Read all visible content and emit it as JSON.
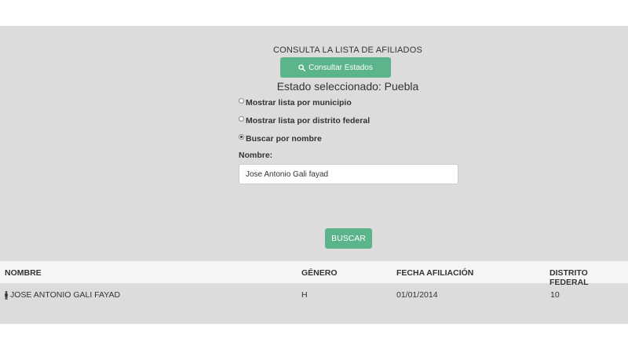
{
  "header": {
    "title": "CONSULTA LA LISTA DE AFILIADOS",
    "consultar_button": "Consultar Estados",
    "estado_label": "Estado seleccionado: Puebla"
  },
  "options": [
    {
      "label": "Mostrar lista por municipio",
      "checked": false
    },
    {
      "label": "Mostrar lista por distrito federal",
      "checked": false
    },
    {
      "label": "Buscar por nombre",
      "checked": true
    }
  ],
  "form": {
    "nombre_label": "Nombre:",
    "nombre_value": "Jose Antonio Gali fayad",
    "buscar_button": "BUSCAR"
  },
  "table": {
    "columns": [
      "NOMBRE",
      "GÉNERO",
      "FECHA AFILIACIÓN",
      "DISTRITO FEDERAL"
    ],
    "rows": [
      {
        "nombre": "JOSE ANTONIO GALI FAYAD",
        "genero": "H",
        "fecha": "01/01/2014",
        "distrito": "10",
        "icon": "male-user-icon"
      }
    ]
  },
  "colors": {
    "accent": "#5bb48a",
    "panel_bg": "#dcdcdc",
    "table_header_bg": "#f5f5f5"
  }
}
